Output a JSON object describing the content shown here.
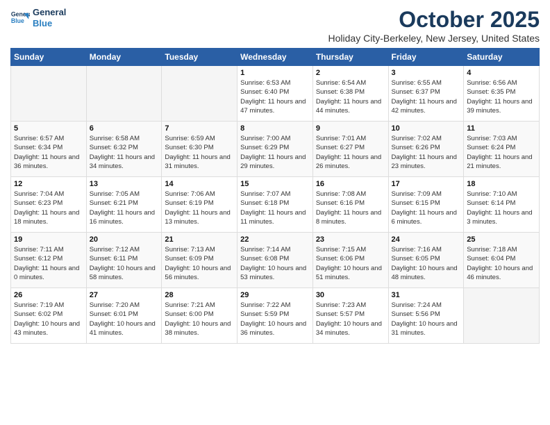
{
  "header": {
    "logo_line1": "General",
    "logo_line2": "Blue",
    "month_title": "October 2025",
    "subtitle": "Holiday City-Berkeley, New Jersey, United States"
  },
  "weekdays": [
    "Sunday",
    "Monday",
    "Tuesday",
    "Wednesday",
    "Thursday",
    "Friday",
    "Saturday"
  ],
  "weeks": [
    [
      {
        "day": "",
        "empty": true
      },
      {
        "day": "",
        "empty": true
      },
      {
        "day": "",
        "empty": true
      },
      {
        "day": "1",
        "sunrise": "6:53 AM",
        "sunset": "6:40 PM",
        "daylight": "11 hours and 47 minutes."
      },
      {
        "day": "2",
        "sunrise": "6:54 AM",
        "sunset": "6:38 PM",
        "daylight": "11 hours and 44 minutes."
      },
      {
        "day": "3",
        "sunrise": "6:55 AM",
        "sunset": "6:37 PM",
        "daylight": "11 hours and 42 minutes."
      },
      {
        "day": "4",
        "sunrise": "6:56 AM",
        "sunset": "6:35 PM",
        "daylight": "11 hours and 39 minutes."
      }
    ],
    [
      {
        "day": "5",
        "sunrise": "6:57 AM",
        "sunset": "6:34 PM",
        "daylight": "11 hours and 36 minutes."
      },
      {
        "day": "6",
        "sunrise": "6:58 AM",
        "sunset": "6:32 PM",
        "daylight": "11 hours and 34 minutes."
      },
      {
        "day": "7",
        "sunrise": "6:59 AM",
        "sunset": "6:30 PM",
        "daylight": "11 hours and 31 minutes."
      },
      {
        "day": "8",
        "sunrise": "7:00 AM",
        "sunset": "6:29 PM",
        "daylight": "11 hours and 29 minutes."
      },
      {
        "day": "9",
        "sunrise": "7:01 AM",
        "sunset": "6:27 PM",
        "daylight": "11 hours and 26 minutes."
      },
      {
        "day": "10",
        "sunrise": "7:02 AM",
        "sunset": "6:26 PM",
        "daylight": "11 hours and 23 minutes."
      },
      {
        "day": "11",
        "sunrise": "7:03 AM",
        "sunset": "6:24 PM",
        "daylight": "11 hours and 21 minutes."
      }
    ],
    [
      {
        "day": "12",
        "sunrise": "7:04 AM",
        "sunset": "6:23 PM",
        "daylight": "11 hours and 18 minutes."
      },
      {
        "day": "13",
        "sunrise": "7:05 AM",
        "sunset": "6:21 PM",
        "daylight": "11 hours and 16 minutes."
      },
      {
        "day": "14",
        "sunrise": "7:06 AM",
        "sunset": "6:19 PM",
        "daylight": "11 hours and 13 minutes."
      },
      {
        "day": "15",
        "sunrise": "7:07 AM",
        "sunset": "6:18 PM",
        "daylight": "11 hours and 11 minutes."
      },
      {
        "day": "16",
        "sunrise": "7:08 AM",
        "sunset": "6:16 PM",
        "daylight": "11 hours and 8 minutes."
      },
      {
        "day": "17",
        "sunrise": "7:09 AM",
        "sunset": "6:15 PM",
        "daylight": "11 hours and 6 minutes."
      },
      {
        "day": "18",
        "sunrise": "7:10 AM",
        "sunset": "6:14 PM",
        "daylight": "11 hours and 3 minutes."
      }
    ],
    [
      {
        "day": "19",
        "sunrise": "7:11 AM",
        "sunset": "6:12 PM",
        "daylight": "11 hours and 0 minutes."
      },
      {
        "day": "20",
        "sunrise": "7:12 AM",
        "sunset": "6:11 PM",
        "daylight": "10 hours and 58 minutes."
      },
      {
        "day": "21",
        "sunrise": "7:13 AM",
        "sunset": "6:09 PM",
        "daylight": "10 hours and 56 minutes."
      },
      {
        "day": "22",
        "sunrise": "7:14 AM",
        "sunset": "6:08 PM",
        "daylight": "10 hours and 53 minutes."
      },
      {
        "day": "23",
        "sunrise": "7:15 AM",
        "sunset": "6:06 PM",
        "daylight": "10 hours and 51 minutes."
      },
      {
        "day": "24",
        "sunrise": "7:16 AM",
        "sunset": "6:05 PM",
        "daylight": "10 hours and 48 minutes."
      },
      {
        "day": "25",
        "sunrise": "7:18 AM",
        "sunset": "6:04 PM",
        "daylight": "10 hours and 46 minutes."
      }
    ],
    [
      {
        "day": "26",
        "sunrise": "7:19 AM",
        "sunset": "6:02 PM",
        "daylight": "10 hours and 43 minutes."
      },
      {
        "day": "27",
        "sunrise": "7:20 AM",
        "sunset": "6:01 PM",
        "daylight": "10 hours and 41 minutes."
      },
      {
        "day": "28",
        "sunrise": "7:21 AM",
        "sunset": "6:00 PM",
        "daylight": "10 hours and 38 minutes."
      },
      {
        "day": "29",
        "sunrise": "7:22 AM",
        "sunset": "5:59 PM",
        "daylight": "10 hours and 36 minutes."
      },
      {
        "day": "30",
        "sunrise": "7:23 AM",
        "sunset": "5:57 PM",
        "daylight": "10 hours and 34 minutes."
      },
      {
        "day": "31",
        "sunrise": "7:24 AM",
        "sunset": "5:56 PM",
        "daylight": "10 hours and 31 minutes."
      },
      {
        "day": "",
        "empty": true
      }
    ]
  ],
  "labels": {
    "sunrise_prefix": "Sunrise: ",
    "sunset_prefix": "Sunset: ",
    "daylight_prefix": "Daylight: "
  }
}
